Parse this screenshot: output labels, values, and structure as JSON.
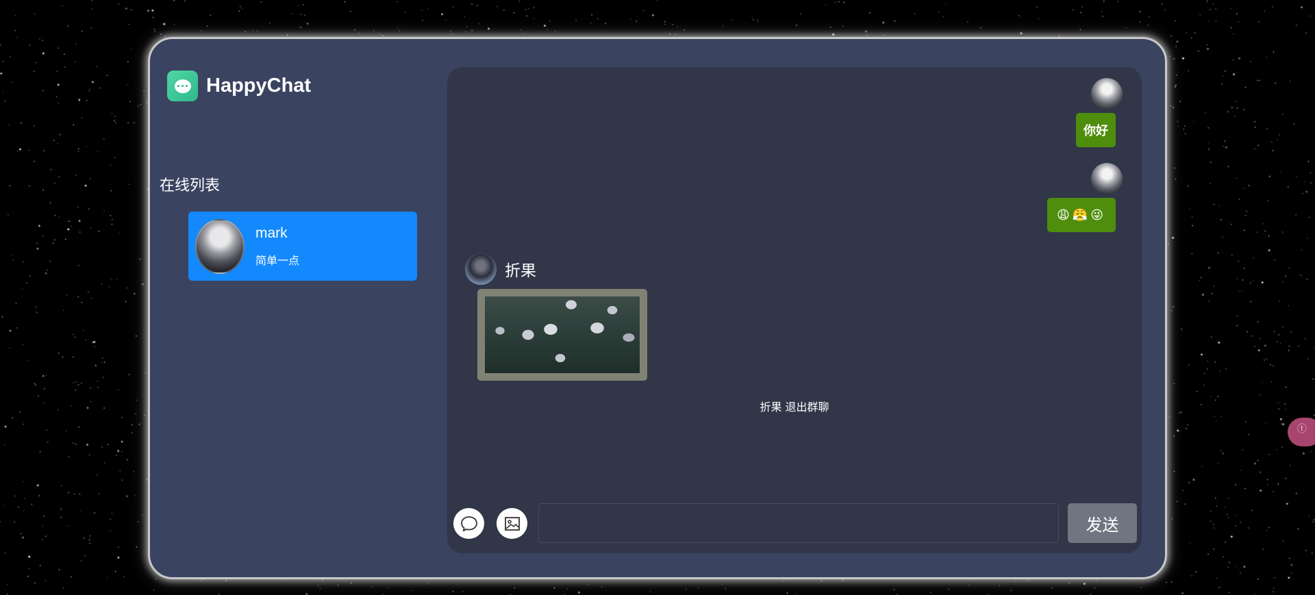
{
  "brand": {
    "name": "HappyChat"
  },
  "sidebar": {
    "title": "在线列表",
    "users": [
      {
        "name": "mark",
        "status": "简单一点"
      }
    ]
  },
  "chat": {
    "messages": [
      {
        "side": "right",
        "text": "你好"
      },
      {
        "side": "right",
        "text": "😩😤😜"
      },
      {
        "side": "left",
        "sender": "折果",
        "type": "image"
      }
    ],
    "system_notice": "折果 退出群聊"
  },
  "composer": {
    "input_value": "",
    "send_label": "发送",
    "emoji_icon": "chat-bubble-icon",
    "image_icon": "image-icon"
  },
  "colors": {
    "panel": "#3a4360",
    "chat_bg": "#313749",
    "selected_user": "#1389fd",
    "own_bubble": "#4e8e0c",
    "send_button": "#6f7681"
  }
}
